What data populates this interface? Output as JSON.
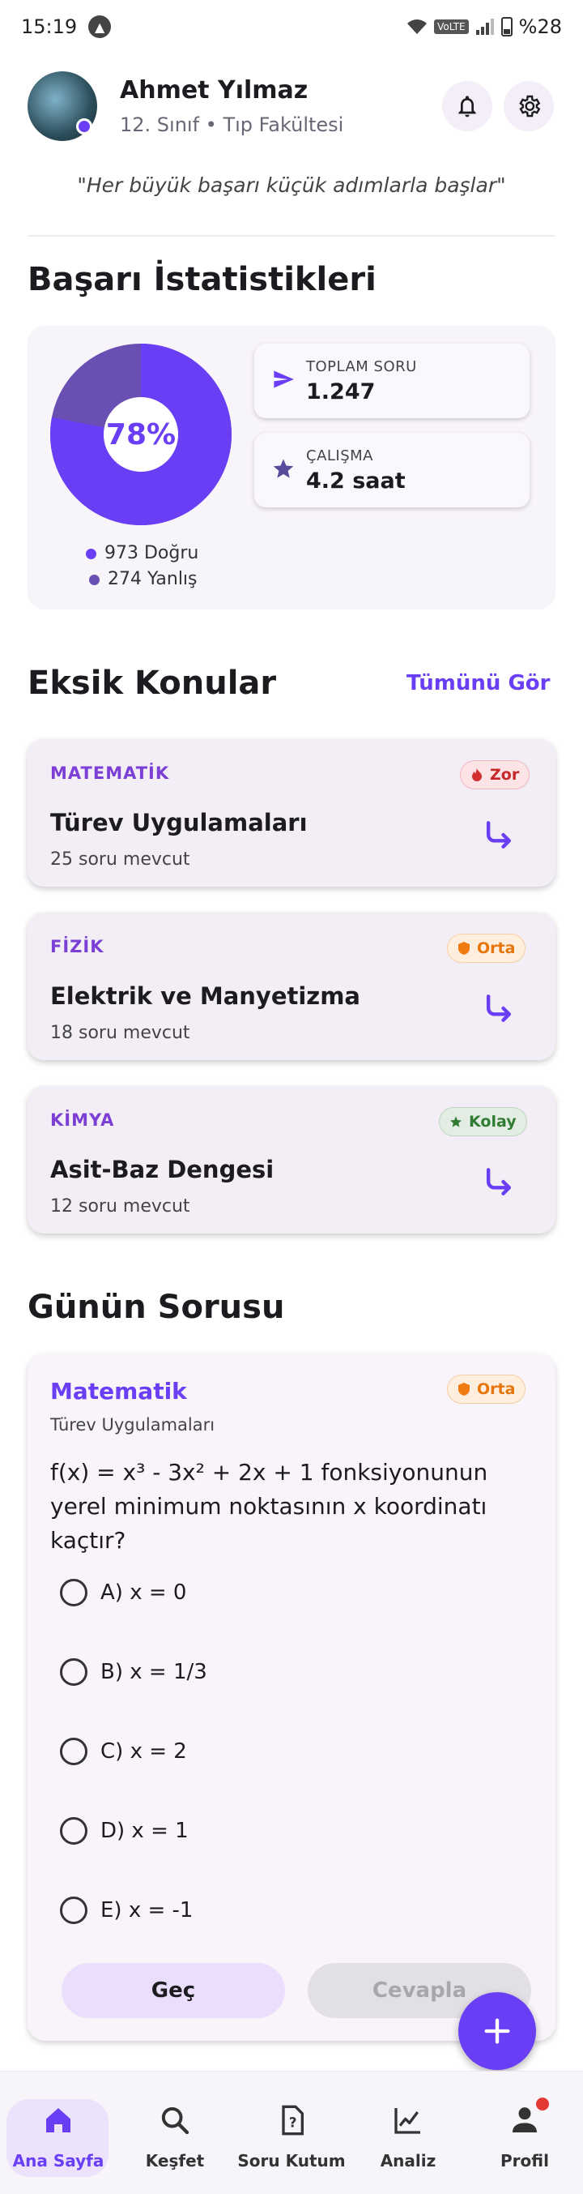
{
  "status_bar": {
    "time": "15:19",
    "volte": "VoLTE",
    "battery": "%28"
  },
  "header": {
    "user_name": "Ahmet Yılmaz",
    "user_sub": "12. Sınıf • Tıp Fakültesi"
  },
  "quote": "\"Her büyük başarı küçük adımlarla başlar\"",
  "stats": {
    "title": "Başarı İstatistikleri",
    "percent_label": "78%",
    "correct_fraction": 0.78,
    "correct_label": "973 Doğru",
    "wrong_label": "274 Yanlış",
    "total_label": "TOPLAM SORU",
    "total_value": "1.247",
    "study_label": "ÇALIŞMA",
    "study_value": "4.2 saat",
    "colors": {
      "correct": "#6a3ef5",
      "wrong": "#6a4fb3",
      "accent": "#6a3ef5"
    }
  },
  "missing": {
    "title": "Eksik Konular",
    "see_all": "Tümünü Gör",
    "items": [
      {
        "subject": "MATEMATİK",
        "title": "Türev Uygulamaları",
        "count": "25 soru mevcut",
        "badge": "Zor",
        "badge_type": "zor",
        "badge_icon": "fire-icon"
      },
      {
        "subject": "FİZİK",
        "title": "Elektrik ve Manyetizma",
        "count": "18 soru mevcut",
        "badge": "Orta",
        "badge_type": "orta",
        "badge_icon": "shield-icon"
      },
      {
        "subject": "KİMYA",
        "title": "Asit-Baz Dengesi",
        "count": "12 soru mevcut",
        "badge": "Kolay",
        "badge_type": "kolay",
        "badge_icon": "star-icon"
      }
    ]
  },
  "daily": {
    "title": "Günün Sorusu",
    "subject": "Matematik",
    "topic": "Türev Uygulamaları",
    "badge": "Orta",
    "question": "f(x) = x³ - 3x² + 2x + 1 fonksiyonunun yerel minimum noktasının x koordinatı kaçtır?",
    "options": [
      "A) x = 0",
      "B) x = 1/3",
      "C) x = 2",
      "D) x = 1",
      "E) x = -1"
    ],
    "skip_label": "Geç",
    "answer_label": "Cevapla"
  },
  "nav": {
    "items": [
      {
        "label": "Ana Sayfa",
        "icon": "home-icon"
      },
      {
        "label": "Keşfet",
        "icon": "search-icon"
      },
      {
        "label": "Soru Kutum",
        "icon": "question-box-icon"
      },
      {
        "label": "Analiz",
        "icon": "chart-icon"
      },
      {
        "label": "Profil",
        "icon": "person-icon"
      }
    ]
  }
}
